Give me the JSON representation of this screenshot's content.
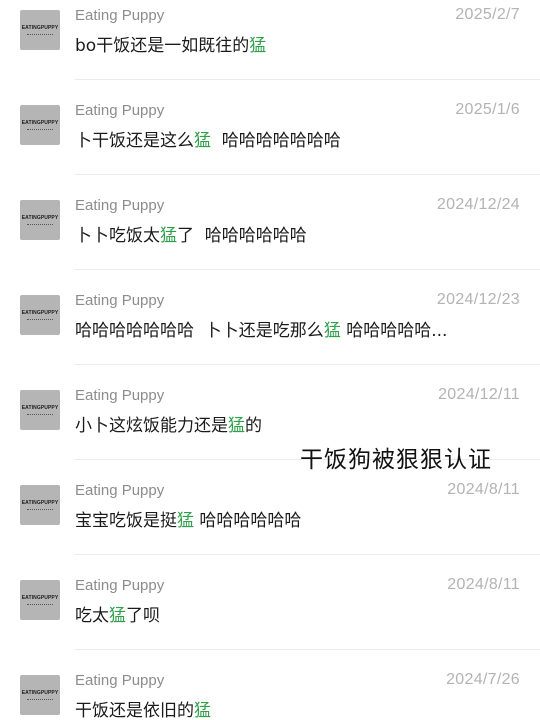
{
  "comments": [
    {
      "name": "Eating Puppy",
      "date": "2025/2/7",
      "avatar_text": "EATINGPUPPY",
      "segments": [
        {
          "t": "bo干饭还是一如既往的",
          "h": false
        },
        {
          "t": "猛",
          "h": true
        }
      ]
    },
    {
      "name": "Eating Puppy",
      "date": "2025/1/6",
      "avatar_text": "EATINGPUPPY",
      "segments": [
        {
          "t": "卜干饭还是这么",
          "h": false
        },
        {
          "t": "猛",
          "h": true
        },
        {
          "t": "  哈哈哈哈哈哈哈",
          "h": false
        }
      ]
    },
    {
      "name": "Eating Puppy",
      "date": "2024/12/24",
      "avatar_text": "EATINGPUPPY",
      "segments": [
        {
          "t": "卜卜吃饭太",
          "h": false
        },
        {
          "t": "猛",
          "h": true
        },
        {
          "t": "了  哈哈哈哈哈哈",
          "h": false
        }
      ]
    },
    {
      "name": "Eating Puppy",
      "date": "2024/12/23",
      "avatar_text": "EATINGPUPPY",
      "segments": [
        {
          "t": "哈哈哈哈哈哈哈  卜卜还是吃那么",
          "h": false
        },
        {
          "t": "猛",
          "h": true
        },
        {
          "t": " 哈哈哈哈哈...",
          "h": false
        }
      ]
    },
    {
      "name": "Eating Puppy",
      "date": "2024/12/11",
      "avatar_text": "EATINGPUPPY",
      "segments": [
        {
          "t": "小卜这炫饭能力还是",
          "h": false
        },
        {
          "t": "猛",
          "h": true
        },
        {
          "t": "的",
          "h": false
        }
      ]
    },
    {
      "name": "Eating Puppy",
      "date": "2024/8/11",
      "avatar_text": "EATINGPUPPY",
      "segments": [
        {
          "t": "宝宝吃饭是挺",
          "h": false
        },
        {
          "t": "猛",
          "h": true
        },
        {
          "t": " 哈哈哈哈哈哈",
          "h": false
        }
      ]
    },
    {
      "name": "Eating Puppy",
      "date": "2024/8/11",
      "avatar_text": "EATINGPUPPY",
      "segments": [
        {
          "t": "吃太",
          "h": false
        },
        {
          "t": "猛",
          "h": true
        },
        {
          "t": "了呗",
          "h": false
        }
      ]
    },
    {
      "name": "Eating Puppy",
      "date": "2024/7/26",
      "avatar_text": "EATINGPUPPY",
      "segments": [
        {
          "t": "干饭还是依旧的",
          "h": false
        },
        {
          "t": "猛",
          "h": true
        }
      ]
    }
  ],
  "overlay_caption": "干饭狗被狠狠认证",
  "colors": {
    "highlight": "#2fa04a",
    "name": "#8c8c8c",
    "date": "#b3b3b3",
    "text": "#1b1b1b",
    "avatar_bg": "#b5b5b5"
  }
}
